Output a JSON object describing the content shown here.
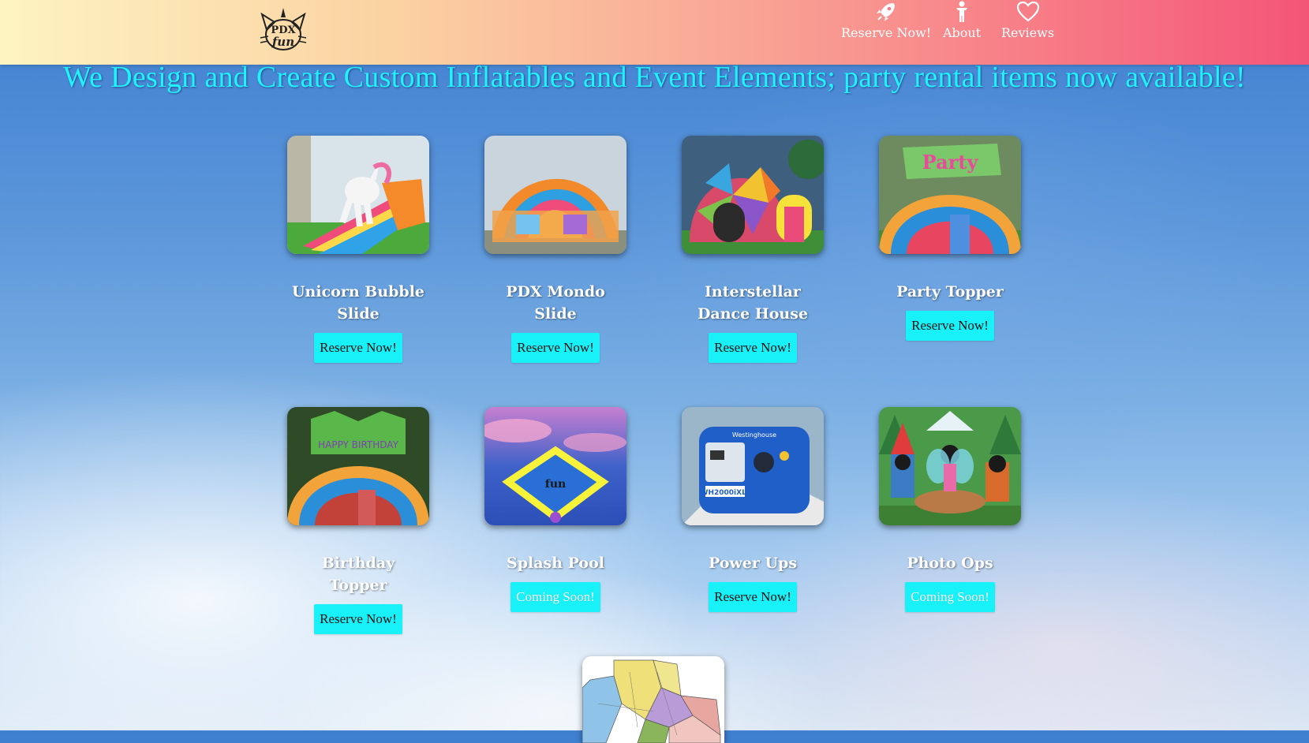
{
  "header": {
    "logo_alt": "PDX Fun",
    "nav": [
      {
        "label": "Reserve Now!",
        "icon": "rocket-icon"
      },
      {
        "label": "About",
        "icon": "person-icon"
      },
      {
        "label": "Reviews",
        "icon": "heart-icon"
      }
    ]
  },
  "hero": {
    "text": "We Design and Create Custom Inflatables and Event Elements; party rental items now available!"
  },
  "products": [
    {
      "title": "Unicorn Bubble Slide",
      "button": "Reserve Now!"
    },
    {
      "title": "PDX Mondo Slide",
      "button": "Reserve Now!"
    },
    {
      "title": "Interstellar Dance House",
      "button": "Reserve Now!"
    },
    {
      "title": "Party Topper",
      "button": "Reserve Now!"
    },
    {
      "title": "Birthday Topper",
      "button": "Reserve Now!"
    },
    {
      "title": "Splash Pool",
      "button": "Coming Soon!"
    },
    {
      "title": "Power Ups",
      "button": "Reserve Now!"
    },
    {
      "title": "Photo Ops",
      "button": "Coming Soon!"
    }
  ],
  "colors": {
    "accent": "#17f1f7",
    "hero_text": "#1ff3ff"
  }
}
